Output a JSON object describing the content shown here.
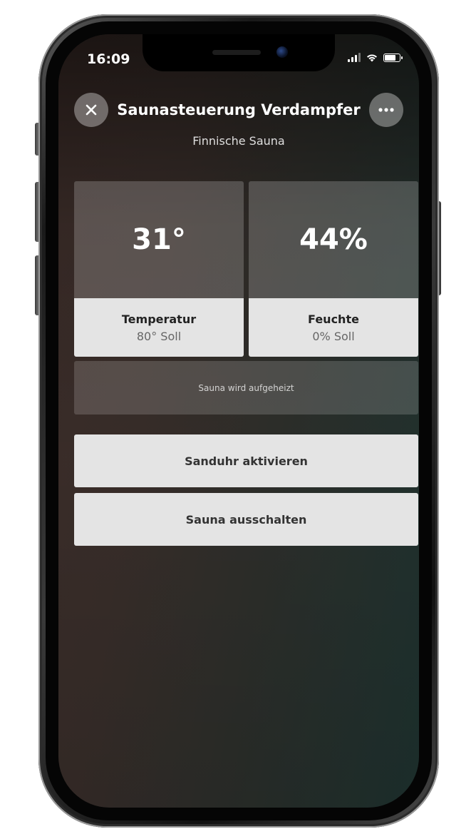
{
  "status_bar": {
    "time": "16:09",
    "signal_icon": "signal-icon",
    "wifi_icon": "wifi-icon",
    "battery_icon": "battery-icon",
    "battery_level": 0.7
  },
  "header": {
    "close_icon": "close-icon",
    "more_icon": "more-icon",
    "title": "Saunasteuerung Verdampfer",
    "subtitle": "Finnische Sauna"
  },
  "tiles": [
    {
      "value": "31°",
      "label": "Temperatur",
      "setpoint": "80° Soll"
    },
    {
      "value": "44%",
      "label": "Feuchte",
      "setpoint": "0% Soll"
    }
  ],
  "status_message": "Sauna wird aufgeheizt",
  "actions": {
    "hourglass_label": "Sanduhr aktivieren",
    "off_label": "Sauna ausschalten"
  },
  "colors": {
    "tile_bottom": "#e4e4e4",
    "text_dark": "#222222"
  }
}
